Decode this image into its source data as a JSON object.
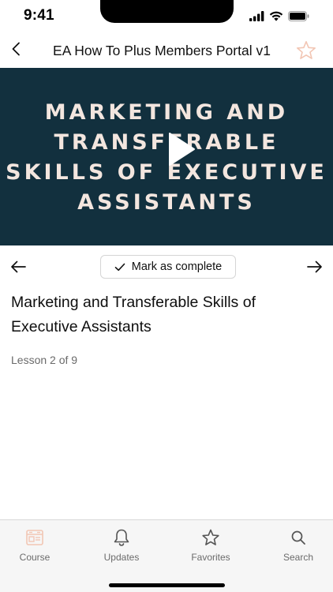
{
  "status_bar": {
    "time": "9:41"
  },
  "header": {
    "title": "EA How To Plus Members Portal v1"
  },
  "video": {
    "title_lines": [
      "MARKETING AND",
      "TRANSFERABLE",
      "SKILLS OF EXECUTIVE",
      "ASSISTANTS"
    ],
    "background_color": "#12303e",
    "title_color": "#f3e6df"
  },
  "lesson_nav": {
    "mark_complete_label": "Mark as complete"
  },
  "lesson": {
    "title": "Marketing and Transferable Skills of Executive Assistants",
    "progress": "Lesson 2 of 9"
  },
  "tab_bar": {
    "tabs": [
      {
        "label": "Course",
        "icon": "course-icon",
        "active": true
      },
      {
        "label": "Updates",
        "icon": "bell-icon"
      },
      {
        "label": "Favorites",
        "icon": "star-icon"
      },
      {
        "label": "Search",
        "icon": "search-icon"
      }
    ]
  },
  "colors": {
    "accent": "#f2c6b4",
    "text_muted": "#6b6b6b"
  }
}
